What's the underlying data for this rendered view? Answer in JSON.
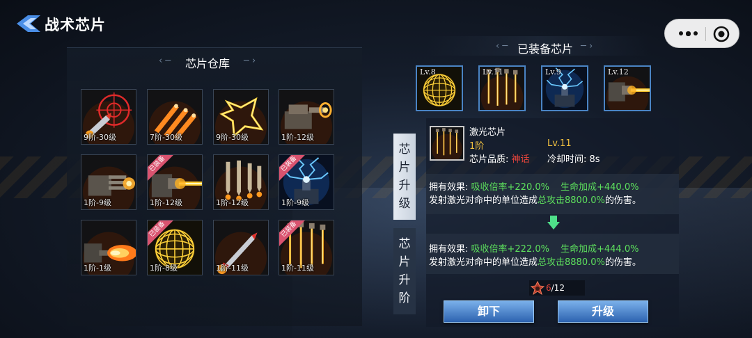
{
  "header": {
    "title": "战术芯片"
  },
  "warehouse": {
    "title": "芯片仓库",
    "slots": [
      {
        "label": "9阶-30级",
        "art": "missile-target"
      },
      {
        "label": "7阶-30级",
        "art": "missile-salvo"
      },
      {
        "label": "9阶-30级",
        "art": "energy-star"
      },
      {
        "label": "1阶-12级",
        "art": "turret"
      },
      {
        "label": "1阶-9级",
        "art": "gatling"
      },
      {
        "label": "1阶-12级",
        "art": "laser-cannon",
        "equipped": "已装备"
      },
      {
        "label": "1阶-12级",
        "art": "missile-rain"
      },
      {
        "label": "1阶-9级",
        "art": "tesla",
        "equipped": "已装备"
      },
      {
        "label": "1阶-1级",
        "art": "flamethrower"
      },
      {
        "label": "1阶-8级",
        "art": "energy-sphere",
        "equipped": "已装备"
      },
      {
        "label": "1阶-11级",
        "art": "rocket"
      },
      {
        "label": "1阶-11级",
        "art": "laser-array",
        "equipped": "已装备"
      }
    ]
  },
  "equipped": {
    "title": "已装备芯片",
    "slots": [
      {
        "level": "Lv.8",
        "art": "energy-sphere"
      },
      {
        "level": "Lv.11",
        "art": "laser-array"
      },
      {
        "level": "Lv.9",
        "art": "tesla"
      },
      {
        "level": "Lv.12",
        "art": "laser-cannon"
      }
    ]
  },
  "tabs": {
    "upgrade": "芯片升级",
    "advance": "芯片升阶"
  },
  "detail": {
    "name": "激光芯片",
    "tier": "1阶",
    "level": "Lv.11",
    "quality_label": "芯片品质: ",
    "quality_value": "神话",
    "cooldown": "冷却时间:  8s",
    "current": {
      "prefix": "拥有效果: ",
      "stat1": "吸收倍率+220.0%",
      "stat2": "生命加成+440.0%",
      "line2_a": "发射激光对命中的单位造成",
      "line2_b": "总攻击8800.0%",
      "line2_c": "的伤害。"
    },
    "next": {
      "prefix": "拥有效果: ",
      "stat1": "吸收倍率+222.0%",
      "stat2": "生命加成+444.0%",
      "line2_a": "发射激光对命中的单位造成",
      "line2_b": "总攻击8880.0%",
      "line2_c": "的伤害。"
    },
    "cost_have": "6",
    "cost_need": "/12"
  },
  "buttons": {
    "unequip": "卸下",
    "upgrade": "升级"
  },
  "colors": {
    "green": "#5de05d",
    "red": "#e8453c",
    "button_blue": "#2d63b0"
  }
}
